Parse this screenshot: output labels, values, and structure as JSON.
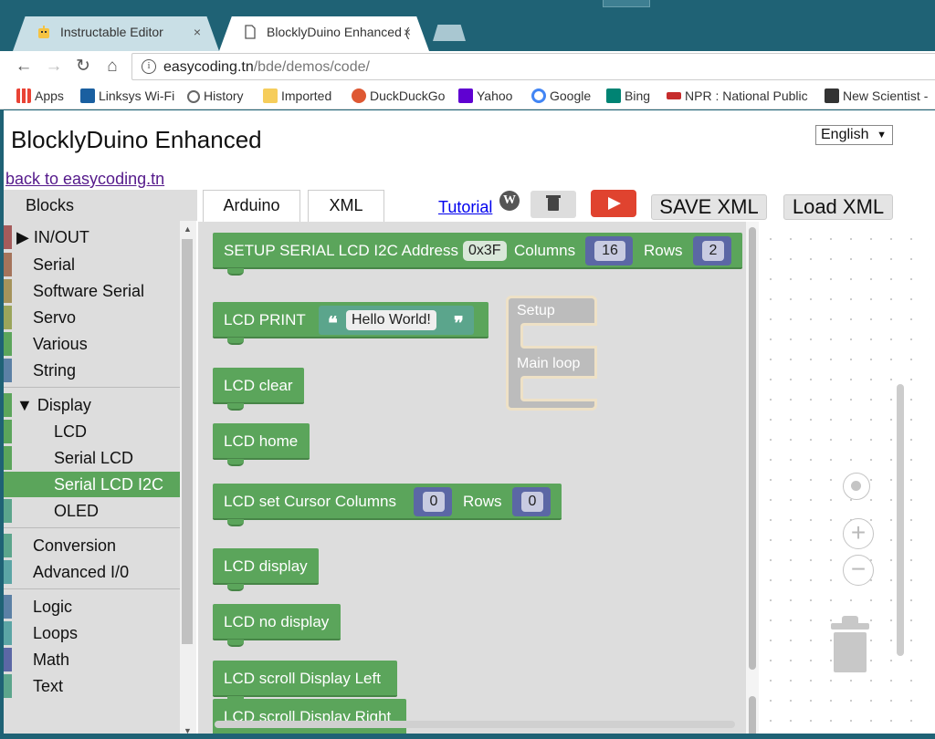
{
  "browser": {
    "tabs": [
      {
        "title": "Instructable Editor",
        "close": "×"
      },
      {
        "title": "BlocklyDuino Enhanced (",
        "close": "×"
      }
    ],
    "nav": {
      "back": "←",
      "forward": "→",
      "reload": "↻",
      "home": "⌂"
    },
    "address": {
      "info": "i",
      "host": "easycoding.tn",
      "path": "/bde/demos/code/"
    },
    "bookmarks": [
      {
        "label": "Apps",
        "color": "#e94335"
      },
      {
        "label": "Linksys Wi-Fi",
        "color": "#1a5fa0"
      },
      {
        "label": "History",
        "color": "#666666"
      },
      {
        "label": "Imported",
        "color": "#f6cd5b"
      },
      {
        "label": "DuckDuckGo",
        "color": "#de5833"
      },
      {
        "label": "Yahoo",
        "color": "#5f01d1"
      },
      {
        "label": "Google",
        "color": "#4285f4"
      },
      {
        "label": "Bing",
        "color": "#008373"
      },
      {
        "label": "NPR : National Public",
        "color": "#c62c2c"
      },
      {
        "label": "New Scientist -",
        "color": "#333333"
      }
    ]
  },
  "page": {
    "title": "BlocklyDuino Enhanced",
    "language": "English",
    "back_link": "back to easycoding.tn"
  },
  "toolbox": {
    "heading": "Blocks",
    "categories": [
      {
        "label": "▶ IN/OUT",
        "color": "#a55b5b"
      },
      {
        "label": "Serial",
        "color": "#a5745b"
      },
      {
        "label": "Software Serial",
        "color": "#a5935b"
      },
      {
        "label": "Servo",
        "color": "#9aa55b"
      },
      {
        "label": "Various",
        "color": "#5ba55b"
      },
      {
        "label": "String",
        "color": "#5b80a5"
      },
      {
        "label": "▼ Display",
        "color": "#5ba55b"
      },
      {
        "label": "LCD",
        "color": "#5ba55b"
      },
      {
        "label": "Serial LCD",
        "color": "#5ba55b"
      },
      {
        "label": "Serial LCD I2C",
        "color": "#5ba55b"
      },
      {
        "label": "OLED",
        "color": "#5ba58c"
      },
      {
        "label": "Conversion",
        "color": "#5ba58c"
      },
      {
        "label": "Advanced I/0",
        "color": "#5ba5a5"
      },
      {
        "label": "Logic",
        "color": "#5b80a5"
      },
      {
        "label": "Loops",
        "color": "#5ba5a5"
      },
      {
        "label": "Math",
        "color": "#5b67a5"
      },
      {
        "label": "Text",
        "color": "#5ba58c"
      }
    ]
  },
  "editor": {
    "tab_arduino": "Arduino",
    "tab_xml": "XML",
    "tutorial": "Tutorial",
    "wp_icon": "W",
    "save_xml": "SAVE XML",
    "load_xml": "Load XML"
  },
  "blocks": {
    "setup_lcd": {
      "label": "SETUP SERIAL LCD I2C Address",
      "address": "0x3F",
      "columns_label": "Columns",
      "columns": "16",
      "rows_label": "Rows",
      "rows": "2"
    },
    "print": {
      "label": "LCD PRINT",
      "open_quote": "❝",
      "value": "Hello World!",
      "close_quote": "❞"
    },
    "clear": "LCD clear",
    "home": "LCD home",
    "cursor": {
      "label": "LCD set Cursor  Columns",
      "columns": "0",
      "rows_label": "Rows",
      "rows": "0"
    },
    "display": "LCD display",
    "no_display": "LCD no display",
    "scroll_left": "LCD scroll Display Left",
    "scroll_right": "LCD scroll Display Right",
    "main": {
      "setup": "Setup",
      "loop": "Main loop"
    }
  },
  "workspace": {
    "zoom_in": "+",
    "zoom_out": "−"
  }
}
